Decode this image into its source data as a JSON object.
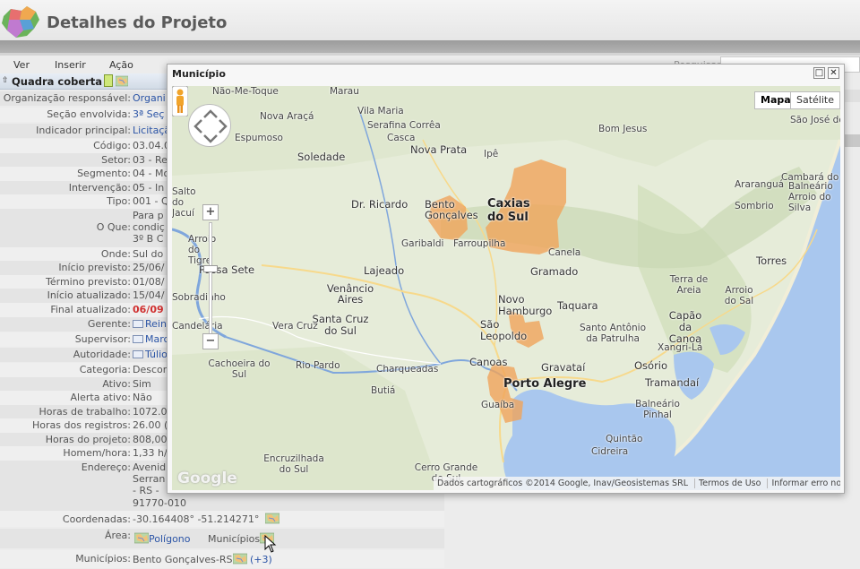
{
  "header": {
    "title": "Detalhes do Projeto"
  },
  "menu": {
    "items": [
      "Ver",
      "Inserir",
      "Ação"
    ],
    "right_label": "Pesquisar"
  },
  "section": {
    "title": "Quadra coberta"
  },
  "details": [
    {
      "label": "Organização responsável:",
      "value": "Organi",
      "style": "link"
    },
    {
      "label": "Seção envolvida:",
      "value": "3ª Seç",
      "style": "link"
    },
    {
      "label": "Indicador principal:",
      "value": "Licitaçã",
      "style": "link"
    },
    {
      "label": "Código:",
      "value": "03.04.0"
    },
    {
      "label": "Setor:",
      "value": "03 - Re"
    },
    {
      "label": "Segmento:",
      "value": "04 - Mo"
    },
    {
      "label": "Intervenção:",
      "value": "05 - In"
    },
    {
      "label": "Tipo:",
      "value": "001 - Q"
    },
    {
      "label": "O Que:",
      "value_lines": [
        "Para p",
        "condiç",
        "3º B C"
      ]
    },
    {
      "label": "Onde:",
      "value": "Sul do"
    },
    {
      "label": "Início previsto:",
      "value": "25/06/"
    },
    {
      "label": "Término previsto:",
      "value": "01/08/"
    },
    {
      "label": "Início atualizado:",
      "value": "15/04/"
    },
    {
      "label": "Final atualizado:",
      "value": "06/09",
      "style": "red"
    },
    {
      "label": "Gerente:",
      "value": "Rein",
      "style": "mail"
    },
    {
      "label": "Supervisor:",
      "value": "Marc",
      "style": "mail"
    },
    {
      "label": "Autoridade:",
      "value": "Túlio",
      "style": "mail"
    },
    {
      "label": "Categoria:",
      "value": "Descor"
    },
    {
      "label": "Ativo:",
      "value": "Sim"
    },
    {
      "label": "Alerta ativo:",
      "value": "Não"
    },
    {
      "label": "Horas de trabalho:",
      "value": "1072.0"
    },
    {
      "label": "Horas dos registros:",
      "value": "26.00 ("
    },
    {
      "label": "Horas do projeto:",
      "value": "808,00"
    },
    {
      "label": "Homem/hora:",
      "value": "1,33 h/"
    },
    {
      "label": "Endereço:",
      "value_lines": [
        "Avenid",
        "Serran",
        "- RS -",
        "91770-010"
      ]
    },
    {
      "label": "Coordenadas:",
      "value": "-30.164408° -51.214271°",
      "style": "map"
    },
    {
      "label": "Área:",
      "links": [
        "Polígono",
        "Municípios"
      ]
    },
    {
      "label": "Municípios:",
      "value": "Bento Gonçalves-RS",
      "extra": "(+3)"
    }
  ],
  "dialog": {
    "title": "Município",
    "map_types": [
      "Mapa",
      "Satélite"
    ],
    "map_type_selected": "Mapa",
    "attribution": [
      "Dados cartográficos ©2014 Google, Inav/Geosistemas SRL",
      "Termos de Uso",
      "Informar erro no mapa"
    ],
    "logo": "Google",
    "cities": [
      "Marau",
      "Não-Me-Toque",
      "Vila Maria",
      "Serafina Corrêa",
      "Casca",
      "Nova Araçá",
      "Espumoso",
      "Soledade",
      "Nova Prata",
      "Ipê",
      "Bom Jesus",
      "São José dos Ausentes",
      "Dr. Ricardo",
      "Bento Gonçalves",
      "Caxias do Sul",
      "Garibaldi",
      "Farroupilha",
      "Canela",
      "Lajeado",
      "Gramado",
      "Venâncio Aires",
      "Novo Hamburgo",
      "Taquara",
      "Santa Cruz do Sul",
      "Vera Cruz",
      "São Leopoldo",
      "Santo Antônio da Patrulha",
      "Cachoeira do Sul",
      "Rio Pardo",
      "Charqueadas",
      "Canoas",
      "Gravataí",
      "Butiá",
      "Porto Alegre",
      "Guaíba",
      "Encruzilhada do Sul",
      "Cerro Grande do Sul",
      "Passa Sete",
      "Arroio do Tigre",
      "Salto do Jacuí",
      "Sobradinho",
      "Candelária",
      "Cambará do Sul",
      "Araranguá",
      "Balneário Arroio do Silva",
      "Sombrio",
      "Torres",
      "Arroio do Sal",
      "Terra de Areia",
      "Capão da Canoa",
      "Xangri-Lá",
      "Osório",
      "Tramandaí",
      "Balneário Pinhal",
      "Quintão",
      "Cidreira"
    ]
  }
}
